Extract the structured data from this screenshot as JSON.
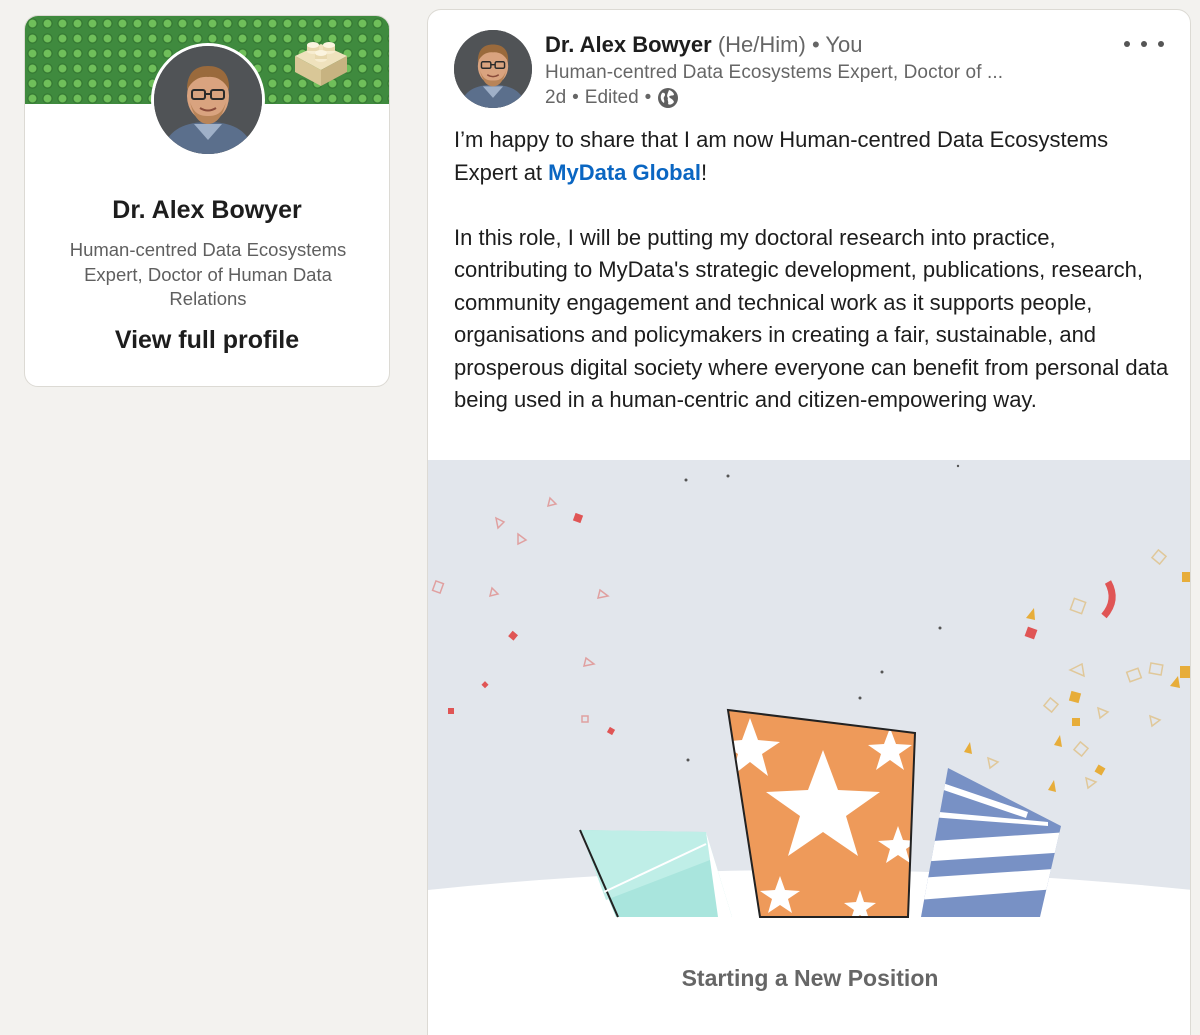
{
  "profile_card": {
    "name": "Dr. Alex Bowyer",
    "headline": "Human-centred Data Ecosystems Expert, Doctor of Human Data Relations",
    "view_profile_label": "View full profile"
  },
  "post": {
    "author_name": "Dr. Alex Bowyer",
    "author_pronouns": "(He/Him)",
    "author_relation": "You",
    "author_headline": "Human-centred Data Ecosystems Expert, Doctor of ...",
    "timestamp": "2d",
    "edited_label": "Edited",
    "body_intro": "I’m happy to share that I am now Human-centred Data Ecosystems Expert at ",
    "body_mention": "MyData Global",
    "body_intro_end": "!",
    "body_paragraph": "In this role, I will be putting my doctoral research into practice, contributing to MyData's strategic development, publications, research, community engagement and technical work as it supports people, organisations and policymakers in creating a fair, sustainable, and prosperous digital society where everyone can benefit from personal data being used in a human-centric and citizen-empowering way.",
    "image_caption": "Starting a New Position"
  },
  "icons": {
    "more": "more-horizontal-icon",
    "visibility": "globe-icon"
  },
  "colors": {
    "page_background": "#f3f2ef",
    "link_blue": "#0a66c2",
    "secondary_text": "#666666",
    "celebration_background": "#e2e6ec",
    "orange_bag": "#ee9a5a",
    "blue_bag": "#7891c5",
    "teal_bag": "#a9e5dd"
  }
}
